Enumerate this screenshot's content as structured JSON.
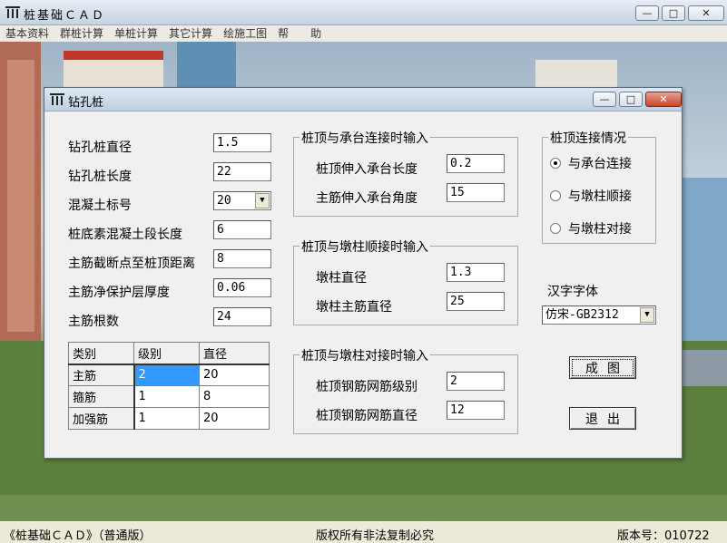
{
  "app": {
    "title": "桩基础ＣＡＤ"
  },
  "menu": [
    "基本资料",
    "群桩计算",
    "单桩计算",
    "其它计算",
    "绘施工图",
    "帮　　助"
  ],
  "dialog": {
    "title": "钻孔桩",
    "fields": [
      {
        "label": "钻孔桩直径",
        "value": "1.5"
      },
      {
        "label": "钻孔桩长度",
        "value": "22"
      },
      {
        "label": "混凝土标号",
        "value": "20"
      },
      {
        "label": "桩底素混凝土段长度",
        "value": "6"
      },
      {
        "label": "主筋截断点至桩顶距离",
        "value": "8"
      },
      {
        "label": "主筋净保护层厚度",
        "value": "0.06"
      },
      {
        "label": "主筋根数",
        "value": "24"
      }
    ],
    "table": {
      "headers": [
        "类别",
        "级别",
        "直径"
      ],
      "rows": [
        [
          "主筋",
          "2",
          "20"
        ],
        [
          "箍筋",
          "1",
          "8"
        ],
        [
          "加强筋",
          "1",
          "20"
        ]
      ]
    },
    "group_cap": {
      "title": "桩顶与承台连接时输入",
      "fields": [
        {
          "label": "桩顶伸入承台长度",
          "value": "0.2"
        },
        {
          "label": "主筋伸入承台角度",
          "value": "15"
        }
      ]
    },
    "group_pier_smooth": {
      "title": "桩顶与墩柱顺接时输入",
      "fields": [
        {
          "label": "墩柱直径",
          "value": "1.3"
        },
        {
          "label": "墩柱主筋直径",
          "value": "25"
        }
      ]
    },
    "group_pier_butt": {
      "title": "桩顶与墩柱对接时输入",
      "fields": [
        {
          "label": "桩顶钢筋网筋级别",
          "value": "2"
        },
        {
          "label": "桩顶钢筋网筋直径",
          "value": "12"
        }
      ]
    },
    "connection": {
      "title": "桩顶连接情况",
      "options": [
        "与承台连接",
        "与墩柱顺接",
        "与墩柱对接"
      ],
      "selected": 0
    },
    "font": {
      "label": "汉字字体",
      "value": "仿宋-GB2312"
    },
    "buttons": {
      "draw": "成图",
      "exit": "退出"
    }
  },
  "status": {
    "left": "《桩基础ＣＡＤ》（普通版）",
    "center": "版权所有非法复制必究",
    "right": "版本号：010722"
  }
}
